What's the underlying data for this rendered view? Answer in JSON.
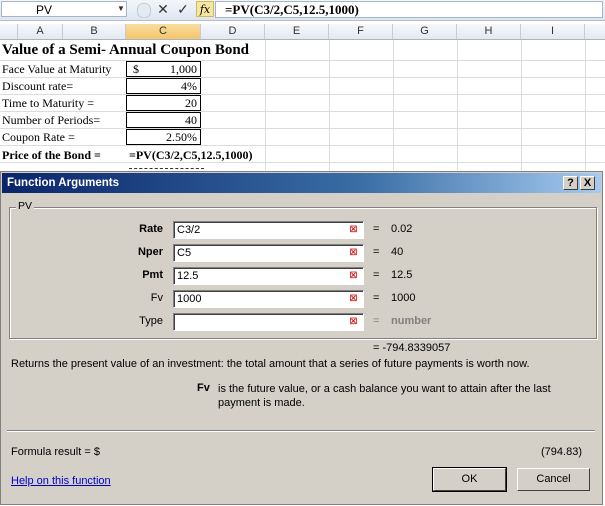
{
  "formula_bar": {
    "name_box": "PV",
    "cancel_glyph": "✕",
    "enter_glyph": "✓",
    "fx_label": "fx",
    "formula": "=PV(C3/2,C5,12.5,1000)"
  },
  "columns": [
    "A",
    "B",
    "C",
    "D",
    "E",
    "F",
    "G",
    "H",
    "I"
  ],
  "sheet": {
    "title": "Value of a Semi- Annual Coupon Bond",
    "rows": [
      {
        "label": "Face Value at Maturity",
        "currency": "$",
        "value": "1,000"
      },
      {
        "label": "Discount rate=",
        "value": "4%"
      },
      {
        "label": "Time to Maturity =",
        "value": "20"
      },
      {
        "label": "Number of Periods=",
        "value": "40"
      },
      {
        "label": "Coupon Rate  =",
        "value": "2.50%"
      }
    ],
    "price_label": "Price of the Bond =",
    "price_formula": "=PV(C3/2,C5,12.5,1000)"
  },
  "dialog": {
    "title": "Function Arguments",
    "help_btn": "?",
    "close_btn": "X",
    "group": "PV",
    "args": [
      {
        "label": "Rate",
        "value": "C3/2",
        "result": "0.02"
      },
      {
        "label": "Nper",
        "value": "C5",
        "result": "40"
      },
      {
        "label": "Pmt",
        "value": "12.5",
        "result": "12.5"
      },
      {
        "label": "Fv",
        "value": "1000",
        "result": "1000"
      },
      {
        "label": "Type",
        "value": "",
        "result": "number"
      }
    ],
    "total": "= -794.8339057",
    "description": "Returns the present value of an investment: the total amount that a series of future payments is worth now.",
    "arg_help_name": "Fv",
    "arg_help_text": "is the future value, or a cash balance you want to attain after the last payment is made.",
    "formula_result_label": "Formula result =   $",
    "formula_result_value": "(794.83)",
    "help_link": "Help on this function",
    "ok": "OK",
    "cancel": "Cancel"
  }
}
